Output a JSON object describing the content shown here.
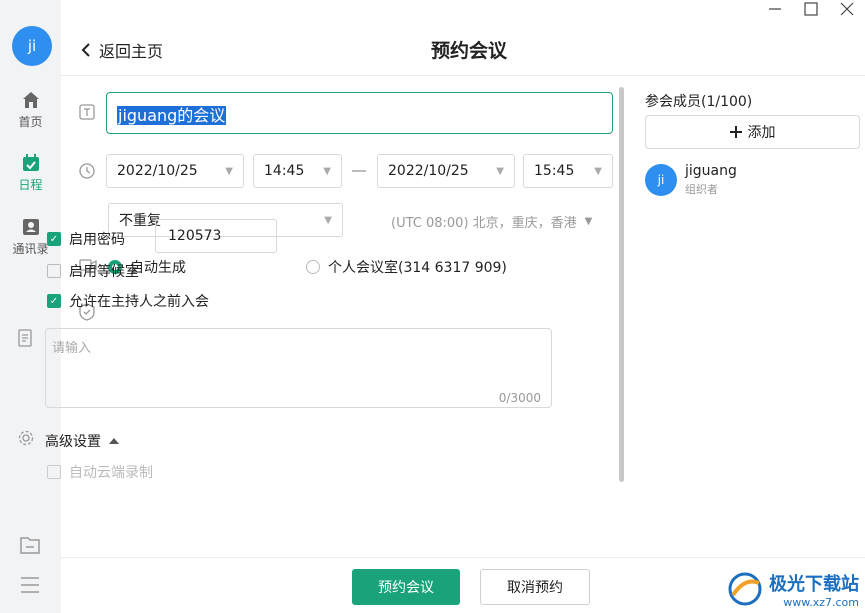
{
  "sidebar": {
    "avatar": "ji",
    "items": [
      {
        "label": "首页",
        "icon": "home-icon"
      },
      {
        "label": "日程",
        "icon": "calendar-icon"
      },
      {
        "label": "通讯录",
        "icon": "contacts-icon"
      }
    ],
    "bottom_icons": [
      "folder-icon",
      "menu-icon"
    ]
  },
  "header": {
    "back_label": "返回主页",
    "title": "预约会议"
  },
  "form": {
    "title_value": "jiguang的会议",
    "start_date": "2022/10/25",
    "start_time": "14:45",
    "end_date": "2022/10/25",
    "end_time": "15:45",
    "repeat": "不重复",
    "timezone": "(UTC 08:00) 北京，重庆，香港",
    "location_options": [
      {
        "label": "自动生成",
        "selected": true
      },
      {
        "label": "个人会议室(314 6317 909)",
        "selected": false
      }
    ],
    "password_enabled_label": "启用密码",
    "password_enabled": true,
    "password_value": "120573",
    "waiting_room_label": "启用等候室",
    "waiting_room": false,
    "join_before_host_label": "允许在主持人之前入会",
    "join_before_host": true,
    "description_placeholder": "请输入",
    "description_count": "0/3000",
    "advanced_label": "高级设置",
    "cloud_record_label": "自动云端录制"
  },
  "members": {
    "title": "参会成员(1/100)",
    "add_label": "添加",
    "list": [
      {
        "avatar": "ji",
        "name": "jiguang",
        "role": "组织者"
      }
    ]
  },
  "footer": {
    "confirm_label": "预约会议",
    "cancel_label": "取消预约"
  },
  "watermark": {
    "name": "极光下载站",
    "url": "www.xz7.com"
  },
  "colors": {
    "accent": "#1aa37a",
    "avatar": "#2e8ff0",
    "selection": "#1f6fd8"
  }
}
